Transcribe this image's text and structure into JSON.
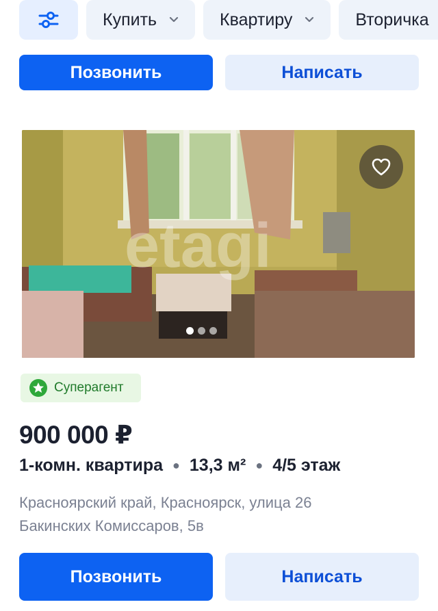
{
  "filters": {
    "buy_label": "Купить",
    "type_label": "Квартиру",
    "market_label": "Вторичка"
  },
  "listing_prev": {
    "call_label": "Позвонить",
    "write_label": "Написать"
  },
  "listing": {
    "photo_watermark": "etagi",
    "photo_count": 3,
    "photo_active_index": 0,
    "badge_label": "Суперагент",
    "price": "900 000 ₽",
    "rooms": "1-комн. квартира",
    "area": "13,3 м²",
    "floor": "4/5 этаж",
    "address_line1": "Красноярский край, Красноярск, улица 26",
    "address_line2": "Бакинских Комиссаров, 5в",
    "call_label": "Позвонить",
    "write_label": "Написать"
  },
  "colors": {
    "primary": "#0d62f2",
    "secondary_bg": "#e7effc",
    "badge_bg": "#e8f7e4",
    "badge_green": "#2ea83a"
  }
}
